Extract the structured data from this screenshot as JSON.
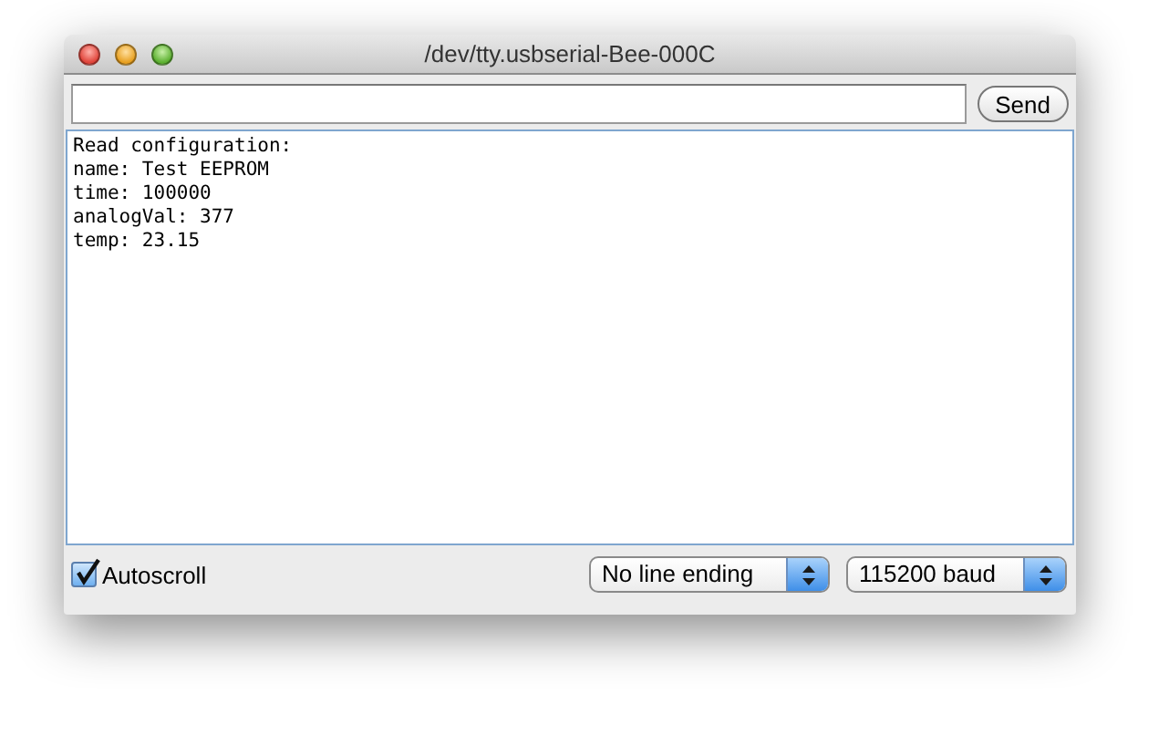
{
  "window": {
    "title": "/dev/tty.usbserial-Bee-000C"
  },
  "send_button": {
    "label": "Send"
  },
  "output": {
    "lines": [
      "Read configuration:",
      "name: Test EEPROM",
      "time: 100000",
      "analogVal: 377",
      "temp: 23.15"
    ]
  },
  "autoscroll": {
    "label": "Autoscroll",
    "checked": true
  },
  "line_ending": {
    "value": "No line ending"
  },
  "baud_rate": {
    "value": "115200 baud"
  }
}
